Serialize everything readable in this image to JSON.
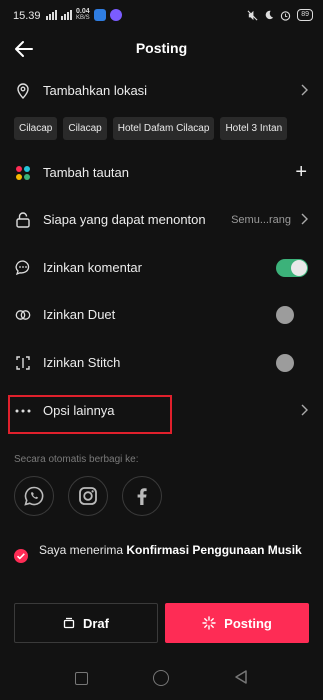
{
  "status": {
    "time": "15.39",
    "net_speed": "0.04",
    "net_unit": "KB/S",
    "battery": "89"
  },
  "header": {
    "title": "Posting"
  },
  "location": {
    "label": "Tambahkan lokasi"
  },
  "location_chips": [
    "Cilacap",
    "Cilacap",
    "Hotel Dafam Cilacap",
    "Hotel 3 Intan"
  ],
  "link": {
    "label": "Tambah tautan"
  },
  "privacy": {
    "label": "Siapa yang dapat menonton",
    "value": "Semu...rang"
  },
  "comments": {
    "label": "Izinkan komentar",
    "on": true
  },
  "duet": {
    "label": "Izinkan Duet",
    "on": false
  },
  "stitch": {
    "label": "Izinkan Stitch",
    "on": false
  },
  "more": {
    "label": "Opsi lainnya"
  },
  "share": {
    "caption": "Secara otomatis berbagi ke:",
    "targets": [
      "whatsapp-icon",
      "instagram-icon",
      "facebook-icon"
    ]
  },
  "consent": {
    "prefix": "Saya menerima ",
    "link": "Konfirmasi Penggunaan Musik"
  },
  "actions": {
    "draft": "Draf",
    "post": "Posting"
  },
  "colors": {
    "accent": "#fe2c55",
    "toggle_on": "#3cb27a",
    "highlight": "#e0202c"
  }
}
